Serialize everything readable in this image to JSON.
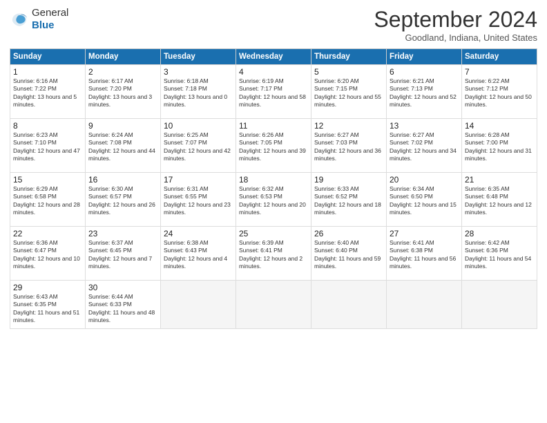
{
  "header": {
    "logo_general": "General",
    "logo_blue": "Blue",
    "title": "September 2024",
    "location": "Goodland, Indiana, United States"
  },
  "weekdays": [
    "Sunday",
    "Monday",
    "Tuesday",
    "Wednesday",
    "Thursday",
    "Friday",
    "Saturday"
  ],
  "weeks": [
    [
      {
        "day": "1",
        "sunrise": "6:16 AM",
        "sunset": "7:22 PM",
        "daylight": "13 hours and 5 minutes."
      },
      {
        "day": "2",
        "sunrise": "6:17 AM",
        "sunset": "7:20 PM",
        "daylight": "13 hours and 3 minutes."
      },
      {
        "day": "3",
        "sunrise": "6:18 AM",
        "sunset": "7:18 PM",
        "daylight": "13 hours and 0 minutes."
      },
      {
        "day": "4",
        "sunrise": "6:19 AM",
        "sunset": "7:17 PM",
        "daylight": "12 hours and 58 minutes."
      },
      {
        "day": "5",
        "sunrise": "6:20 AM",
        "sunset": "7:15 PM",
        "daylight": "12 hours and 55 minutes."
      },
      {
        "day": "6",
        "sunrise": "6:21 AM",
        "sunset": "7:13 PM",
        "daylight": "12 hours and 52 minutes."
      },
      {
        "day": "7",
        "sunrise": "6:22 AM",
        "sunset": "7:12 PM",
        "daylight": "12 hours and 50 minutes."
      }
    ],
    [
      {
        "day": "8",
        "sunrise": "6:23 AM",
        "sunset": "7:10 PM",
        "daylight": "12 hours and 47 minutes."
      },
      {
        "day": "9",
        "sunrise": "6:24 AM",
        "sunset": "7:08 PM",
        "daylight": "12 hours and 44 minutes."
      },
      {
        "day": "10",
        "sunrise": "6:25 AM",
        "sunset": "7:07 PM",
        "daylight": "12 hours and 42 minutes."
      },
      {
        "day": "11",
        "sunrise": "6:26 AM",
        "sunset": "7:05 PM",
        "daylight": "12 hours and 39 minutes."
      },
      {
        "day": "12",
        "sunrise": "6:27 AM",
        "sunset": "7:03 PM",
        "daylight": "12 hours and 36 minutes."
      },
      {
        "day": "13",
        "sunrise": "6:27 AM",
        "sunset": "7:02 PM",
        "daylight": "12 hours and 34 minutes."
      },
      {
        "day": "14",
        "sunrise": "6:28 AM",
        "sunset": "7:00 PM",
        "daylight": "12 hours and 31 minutes."
      }
    ],
    [
      {
        "day": "15",
        "sunrise": "6:29 AM",
        "sunset": "6:58 PM",
        "daylight": "12 hours and 28 minutes."
      },
      {
        "day": "16",
        "sunrise": "6:30 AM",
        "sunset": "6:57 PM",
        "daylight": "12 hours and 26 minutes."
      },
      {
        "day": "17",
        "sunrise": "6:31 AM",
        "sunset": "6:55 PM",
        "daylight": "12 hours and 23 minutes."
      },
      {
        "day": "18",
        "sunrise": "6:32 AM",
        "sunset": "6:53 PM",
        "daylight": "12 hours and 20 minutes."
      },
      {
        "day": "19",
        "sunrise": "6:33 AM",
        "sunset": "6:52 PM",
        "daylight": "12 hours and 18 minutes."
      },
      {
        "day": "20",
        "sunrise": "6:34 AM",
        "sunset": "6:50 PM",
        "daylight": "12 hours and 15 minutes."
      },
      {
        "day": "21",
        "sunrise": "6:35 AM",
        "sunset": "6:48 PM",
        "daylight": "12 hours and 12 minutes."
      }
    ],
    [
      {
        "day": "22",
        "sunrise": "6:36 AM",
        "sunset": "6:47 PM",
        "daylight": "12 hours and 10 minutes."
      },
      {
        "day": "23",
        "sunrise": "6:37 AM",
        "sunset": "6:45 PM",
        "daylight": "12 hours and 7 minutes."
      },
      {
        "day": "24",
        "sunrise": "6:38 AM",
        "sunset": "6:43 PM",
        "daylight": "12 hours and 4 minutes."
      },
      {
        "day": "25",
        "sunrise": "6:39 AM",
        "sunset": "6:41 PM",
        "daylight": "12 hours and 2 minutes."
      },
      {
        "day": "26",
        "sunrise": "6:40 AM",
        "sunset": "6:40 PM",
        "daylight": "11 hours and 59 minutes."
      },
      {
        "day": "27",
        "sunrise": "6:41 AM",
        "sunset": "6:38 PM",
        "daylight": "11 hours and 56 minutes."
      },
      {
        "day": "28",
        "sunrise": "6:42 AM",
        "sunset": "6:36 PM",
        "daylight": "11 hours and 54 minutes."
      }
    ],
    [
      {
        "day": "29",
        "sunrise": "6:43 AM",
        "sunset": "6:35 PM",
        "daylight": "11 hours and 51 minutes."
      },
      {
        "day": "30",
        "sunrise": "6:44 AM",
        "sunset": "6:33 PM",
        "daylight": "11 hours and 48 minutes."
      },
      null,
      null,
      null,
      null,
      null
    ]
  ]
}
